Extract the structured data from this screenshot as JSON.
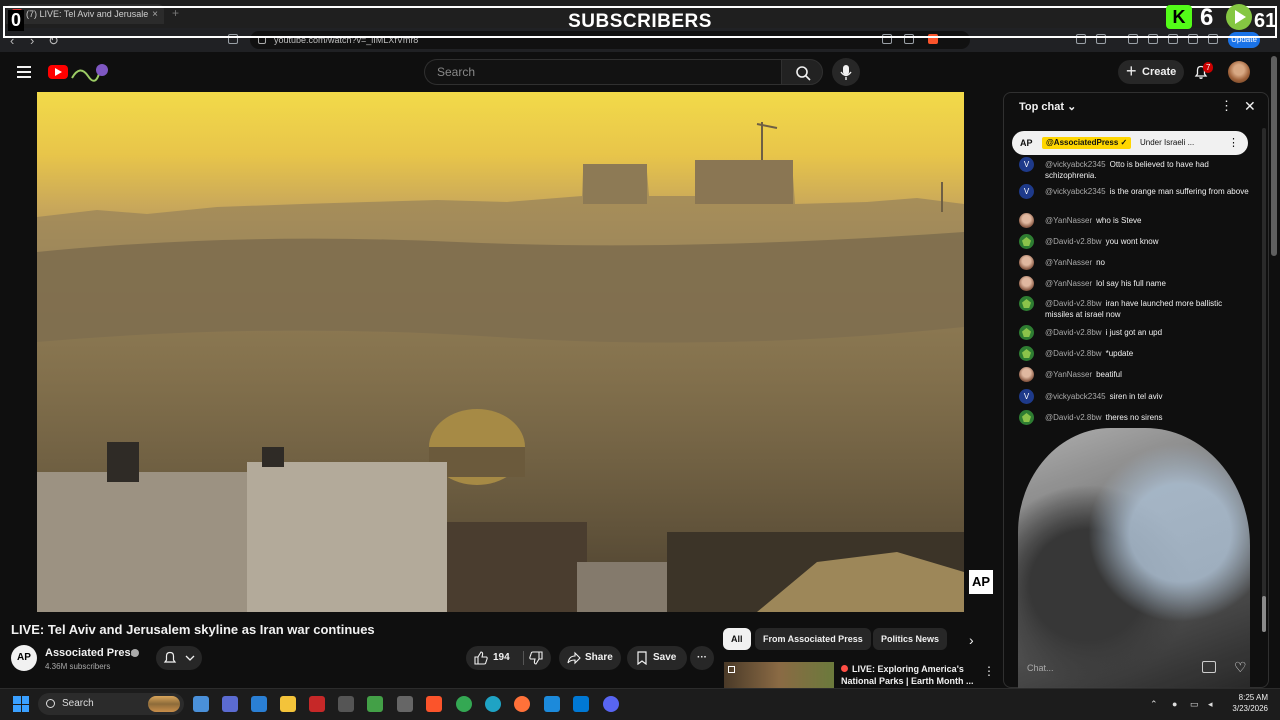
{
  "browser": {
    "tab_title": "(7) LIVE: Tel Aviv and Jerusale...",
    "tab_close": "×",
    "new_tab": "+",
    "url": "youtube.com/watch?v=_iIMLXfVmr8",
    "update_label": "Update"
  },
  "overlay": {
    "title": "SUBSCRIBERS",
    "left_count": "0",
    "kick_letter": "K",
    "kick_count": "6",
    "rumble_count": "61"
  },
  "header": {
    "search_placeholder": "Search",
    "create_label": "Create",
    "notification_count": "7"
  },
  "video": {
    "title": "LIVE: Tel Aviv and Jerusalem skyline as Iran war continues",
    "watermark": "AP",
    "channel": {
      "avatar_text": "AP",
      "name": "Associated Press",
      "subscribers": "4.36M subscribers"
    },
    "actions": {
      "like_count": "194",
      "share_label": "Share",
      "save_label": "Save",
      "more_label": "···"
    }
  },
  "recommendations": {
    "chips": [
      "All",
      "From Associated Press",
      "Politics News"
    ],
    "next_label": "›",
    "item": {
      "title": "LIVE: Exploring America's National Parks | Earth Month ..."
    }
  },
  "chat": {
    "header": "Top chat",
    "pinned": {
      "avatar_text": "AP",
      "author": "@AssociatedPress ✓",
      "text": "Under Israeli ..."
    },
    "messages": [
      {
        "author": "@vickyabck2345",
        "text": "Otto is believed to have had schizophrenia.",
        "avatar": "v"
      },
      {
        "author": "@vickyabck2345",
        "text": "is the orange man suffering from above",
        "avatar": "v"
      },
      {
        "author": "@YanNasser",
        "text": "who is Steve",
        "avatar": "y"
      },
      {
        "author": "@David-v2.8bw",
        "text": "you wont know",
        "avatar": "d"
      },
      {
        "author": "@YanNasser",
        "text": "no",
        "avatar": "y"
      },
      {
        "author": "@YanNasser",
        "text": "lol say his full name",
        "avatar": "y"
      },
      {
        "author": "@David-v2.8bw",
        "text": "iran have launched more ballistic missiles at israel now",
        "avatar": "d"
      },
      {
        "author": "@David-v2.8bw",
        "text": "i just got an upd",
        "avatar": "d"
      },
      {
        "author": "@David-v2.8bw",
        "text": "*update",
        "avatar": "d"
      },
      {
        "author": "@YanNasser",
        "text": "beatiful",
        "avatar": "y"
      },
      {
        "author": "@vickyabck2345",
        "text": "siren in tel aviv",
        "avatar": "v"
      },
      {
        "author": "@David-v2.8bw",
        "text": "theres no sirens",
        "avatar": "d"
      }
    ],
    "input_placeholder": "Chat..."
  },
  "taskbar": {
    "search_label": "Search",
    "time": "8:25 AM",
    "date": "3/23/2026"
  }
}
